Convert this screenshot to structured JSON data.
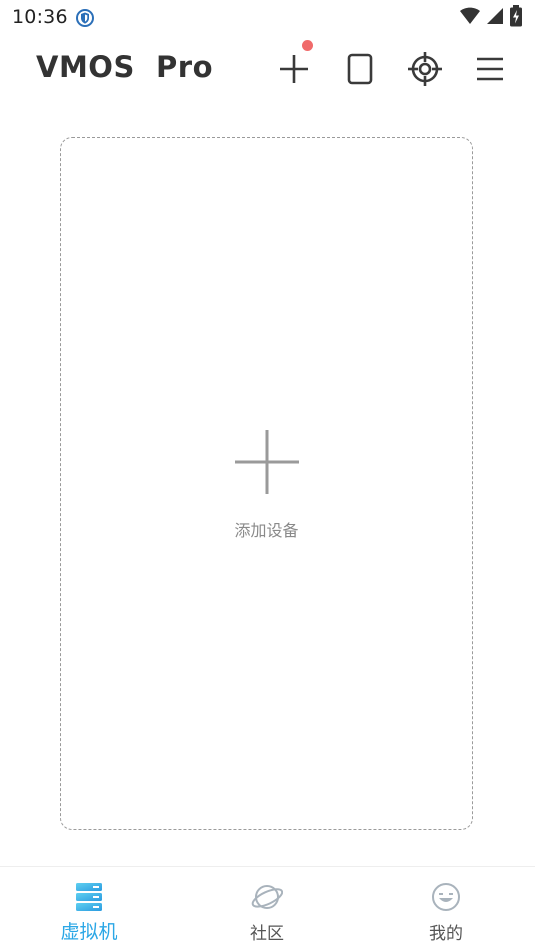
{
  "status_bar": {
    "time": "10:36",
    "icons": [
      "shield-notification-icon",
      "wifi-icon",
      "signal-icon",
      "battery-charging-icon"
    ]
  },
  "header": {
    "title": "VMOS  Pro",
    "actions": [
      {
        "name": "add",
        "icon": "plus-icon",
        "has_badge": true
      },
      {
        "name": "device",
        "icon": "phone-outline-icon"
      },
      {
        "name": "locate",
        "icon": "target-icon"
      },
      {
        "name": "menu",
        "icon": "hamburger-menu-icon"
      }
    ]
  },
  "main": {
    "add_device_label": "添加设备",
    "add_device_icon": "plus-icon"
  },
  "bottom_nav": {
    "items": [
      {
        "label": "虚拟机",
        "icon": "server-stack-icon",
        "active": true
      },
      {
        "label": "社区",
        "icon": "planet-icon",
        "active": false
      },
      {
        "label": "我的",
        "icon": "smiley-face-icon",
        "active": false
      }
    ]
  },
  "colors": {
    "accent": "#2ba7e6",
    "badge": "#f06a6a",
    "icon_dark": "#3a3a3a",
    "icon_muted": "#9a9a9a",
    "text_muted": "#8a8a8a",
    "nav_inactive_icon": "#a9b3bc"
  }
}
